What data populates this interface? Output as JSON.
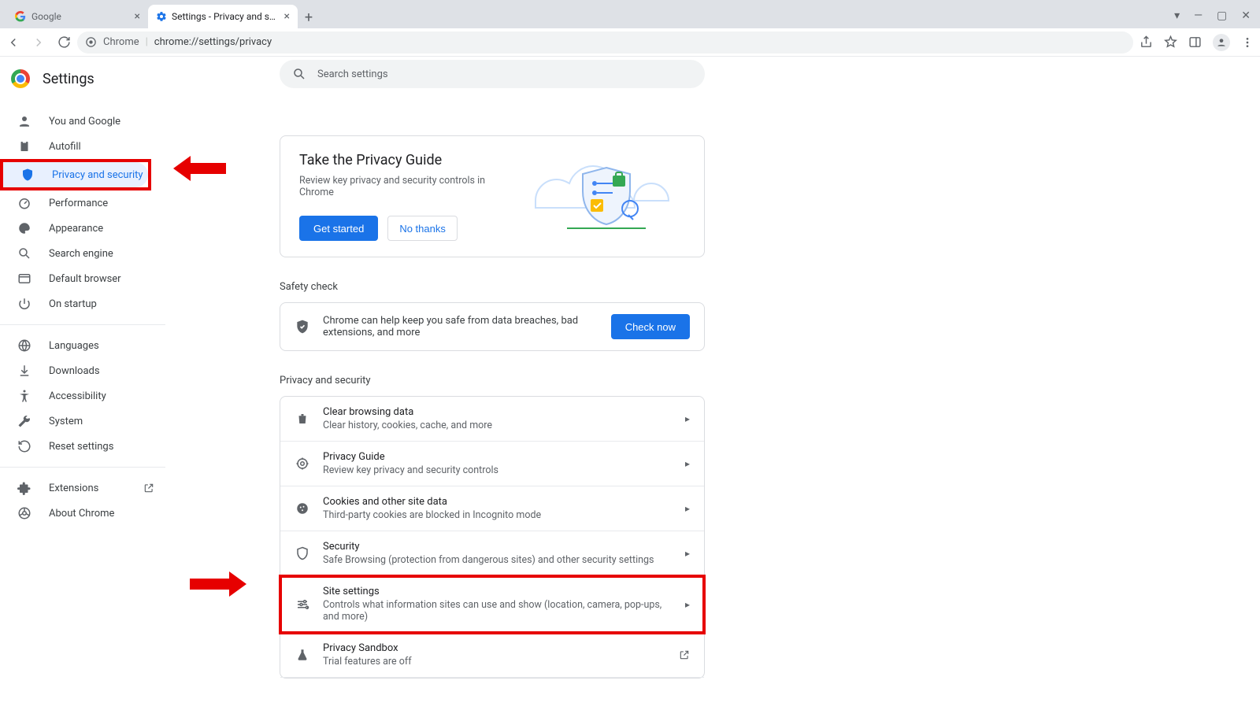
{
  "tabs": [
    {
      "title": "Google"
    },
    {
      "title": "Settings - Privacy and security"
    }
  ],
  "omnibox": {
    "scheme_label": "Chrome",
    "url_text": "chrome://settings/privacy"
  },
  "header": {
    "title": "Settings"
  },
  "search": {
    "placeholder": "Search settings"
  },
  "sidebar": {
    "groups": [
      [
        {
          "label": "You and Google"
        },
        {
          "label": "Autofill"
        },
        {
          "label": "Privacy and security"
        },
        {
          "label": "Performance"
        },
        {
          "label": "Appearance"
        },
        {
          "label": "Search engine"
        },
        {
          "label": "Default browser"
        },
        {
          "label": "On startup"
        }
      ],
      [
        {
          "label": "Languages"
        },
        {
          "label": "Downloads"
        },
        {
          "label": "Accessibility"
        },
        {
          "label": "System"
        },
        {
          "label": "Reset settings"
        }
      ],
      [
        {
          "label": "Extensions"
        },
        {
          "label": "About Chrome"
        }
      ]
    ]
  },
  "guide": {
    "title": "Take the Privacy Guide",
    "subtitle": "Review key privacy and security controls in Chrome",
    "primary": "Get started",
    "secondary": "No thanks"
  },
  "safety": {
    "section": "Safety check",
    "text": "Chrome can help keep you safe from data breaches, bad extensions, and more",
    "button": "Check now"
  },
  "privacy": {
    "section": "Privacy and security",
    "rows": [
      {
        "title": "Clear browsing data",
        "sub": "Clear history, cookies, cache, and more"
      },
      {
        "title": "Privacy Guide",
        "sub": "Review key privacy and security controls"
      },
      {
        "title": "Cookies and other site data",
        "sub": "Third-party cookies are blocked in Incognito mode"
      },
      {
        "title": "Security",
        "sub": "Safe Browsing (protection from dangerous sites) and other security settings"
      },
      {
        "title": "Site settings",
        "sub": "Controls what information sites can use and show (location, camera, pop-ups, and more)"
      },
      {
        "title": "Privacy Sandbox",
        "sub": "Trial features are off"
      }
    ]
  }
}
